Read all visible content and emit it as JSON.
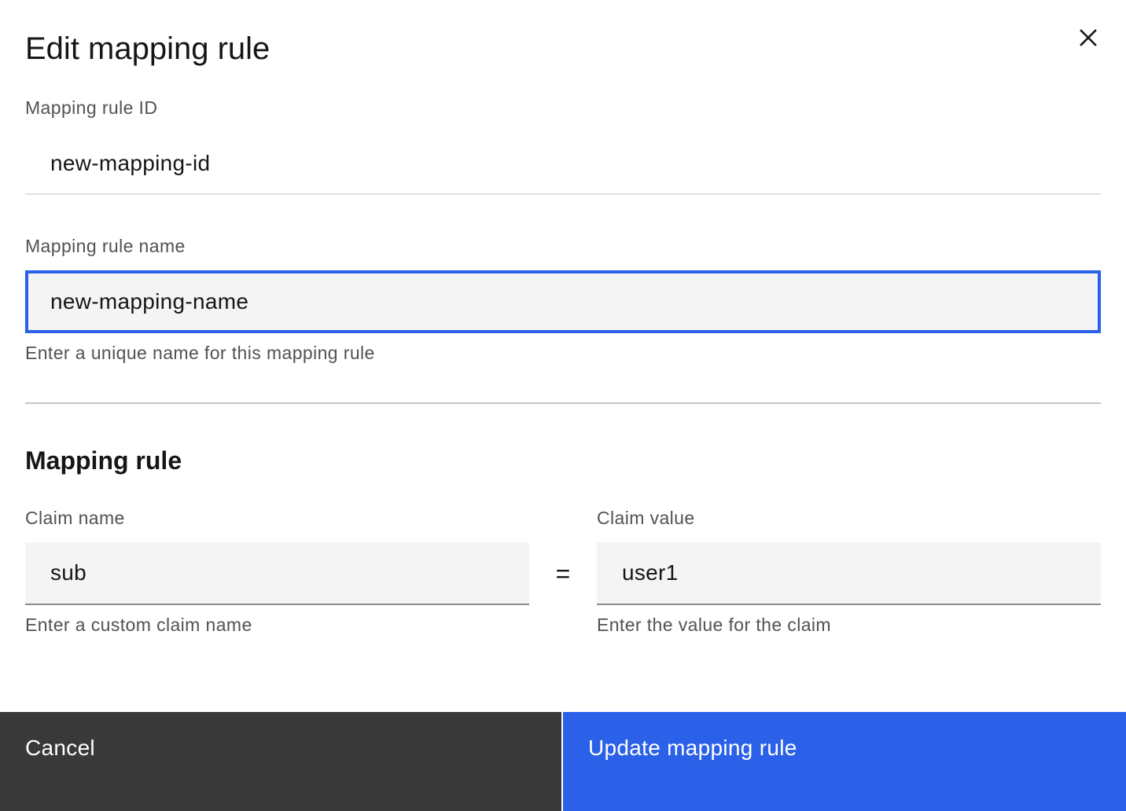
{
  "modal": {
    "title": "Edit mapping rule"
  },
  "icons": {
    "close": "close-icon"
  },
  "mapping_rule_id": {
    "label": "Mapping rule ID",
    "value": "new-mapping-id"
  },
  "mapping_rule_name": {
    "label": "Mapping rule name",
    "value": "new-mapping-name",
    "helper": "Enter a unique name for this mapping rule"
  },
  "mapping_rule_section": {
    "heading": "Mapping rule",
    "operator": "=",
    "claim_name": {
      "label": "Claim name",
      "value": "sub",
      "helper": "Enter a custom claim name"
    },
    "claim_value": {
      "label": "Claim value",
      "value": "user1",
      "helper": "Enter the value for the claim"
    }
  },
  "footer": {
    "cancel_label": "Cancel",
    "submit_label": "Update mapping rule"
  },
  "colors": {
    "primary": "#2b60e8",
    "secondary_button": "#393939",
    "field_background": "#f4f4f4",
    "text": "#161616",
    "helper_text": "#525252"
  }
}
